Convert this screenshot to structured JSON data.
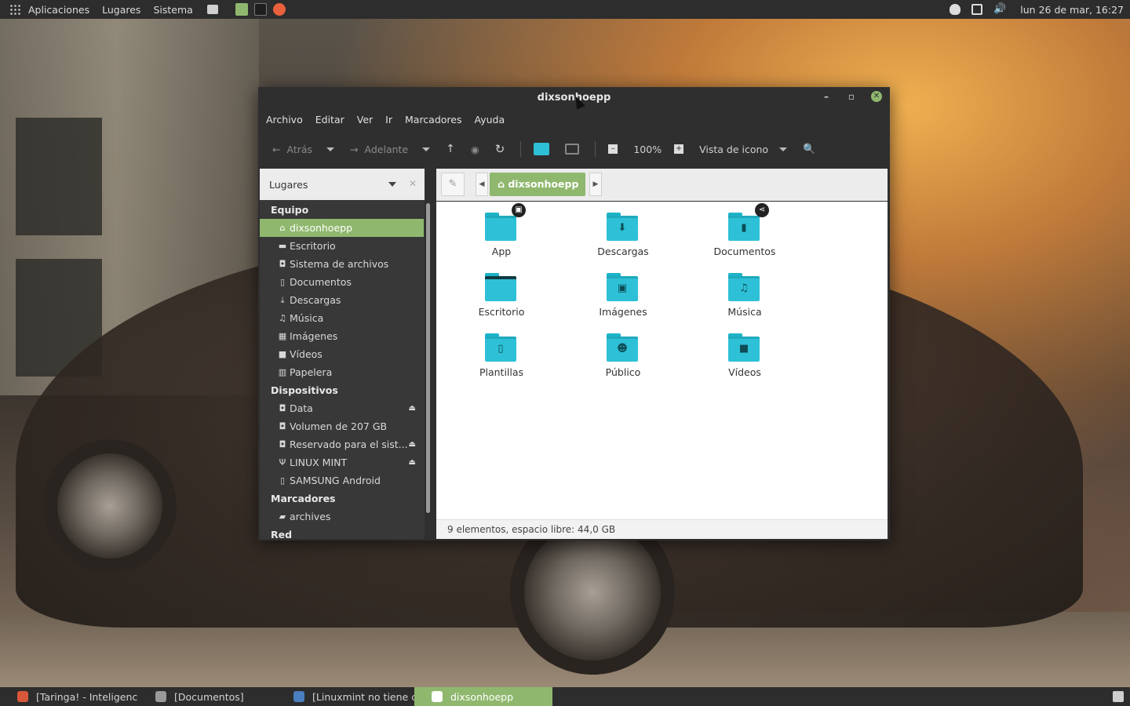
{
  "top_panel": {
    "menu_apps": "Aplicaciones",
    "menu_places": "Lugares",
    "menu_system": "Sistema",
    "clock": "lun 26 de mar, 16:27"
  },
  "window": {
    "title": "dixsonhoepp",
    "minimize": "–",
    "maximize": "▫",
    "close": "✕"
  },
  "menubar": [
    "Archivo",
    "Editar",
    "Ver",
    "Ir",
    "Marcadores",
    "Ayuda"
  ],
  "toolbar": {
    "back": "Atrás",
    "forward": "Adelante",
    "zoom": "100%",
    "view_mode": "Vista de icono"
  },
  "sidebar": {
    "header": "Lugares",
    "sections": [
      {
        "title": "Equipo",
        "items": [
          {
            "label": "dixsonhoepp",
            "icon": "home-icon",
            "active": true
          },
          {
            "label": "Escritorio",
            "icon": "desktop-icon"
          },
          {
            "label": "Sistema de archivos",
            "icon": "drive-icon"
          },
          {
            "label": "Documentos",
            "icon": "document-icon"
          },
          {
            "label": "Descargas",
            "icon": "download-icon"
          },
          {
            "label": "Música",
            "icon": "music-icon"
          },
          {
            "label": "Imágenes",
            "icon": "image-icon"
          },
          {
            "label": "Vídeos",
            "icon": "video-icon"
          },
          {
            "label": "Papelera",
            "icon": "trash-icon"
          }
        ]
      },
      {
        "title": "Dispositivos",
        "items": [
          {
            "label": "Data",
            "icon": "drive-icon",
            "eject": true
          },
          {
            "label": "Volumen de 207 GB",
            "icon": "drive-icon"
          },
          {
            "label": "Reservado para el sist...",
            "icon": "drive-icon",
            "eject": true
          },
          {
            "label": "LINUX MINT",
            "icon": "usb-icon",
            "eject": true
          },
          {
            "label": "SAMSUNG Android",
            "icon": "phone-icon"
          }
        ]
      },
      {
        "title": "Marcadores",
        "items": [
          {
            "label": "archives",
            "icon": "folder-icon"
          }
        ]
      },
      {
        "title": "Red",
        "items": []
      }
    ]
  },
  "pathbar": {
    "current": "dixsonhoepp"
  },
  "files": [
    {
      "name": "App",
      "glyph": "",
      "emblem": "lock-emblem"
    },
    {
      "name": "Descargas",
      "glyph": "⬇"
    },
    {
      "name": "Documentos",
      "glyph": "▮",
      "emblem": "share-emblem"
    },
    {
      "name": "Escritorio",
      "glyph": "",
      "desktop": true
    },
    {
      "name": "Imágenes",
      "glyph": "▣"
    },
    {
      "name": "Música",
      "glyph": "♫"
    },
    {
      "name": "Plantillas",
      "glyph": "▯"
    },
    {
      "name": "Público",
      "glyph": "☻"
    },
    {
      "name": "Vídeos",
      "glyph": "■"
    }
  ],
  "statusbar": "9 elementos, espacio libre: 44,0 GB",
  "taskbar": [
    {
      "label": "[Taringa! - Inteligenc...",
      "color": "#d9583a"
    },
    {
      "label": "[Documentos]",
      "color": "#9a9a9a"
    },
    {
      "label": "[Linuxmint no tiene c...",
      "color": "#4a7fc0"
    },
    {
      "label": "dixsonhoepp",
      "color": "#ffffff",
      "active": true
    }
  ],
  "colors": {
    "accent": "#8fb86e",
    "folder": "#2ec0d6"
  }
}
